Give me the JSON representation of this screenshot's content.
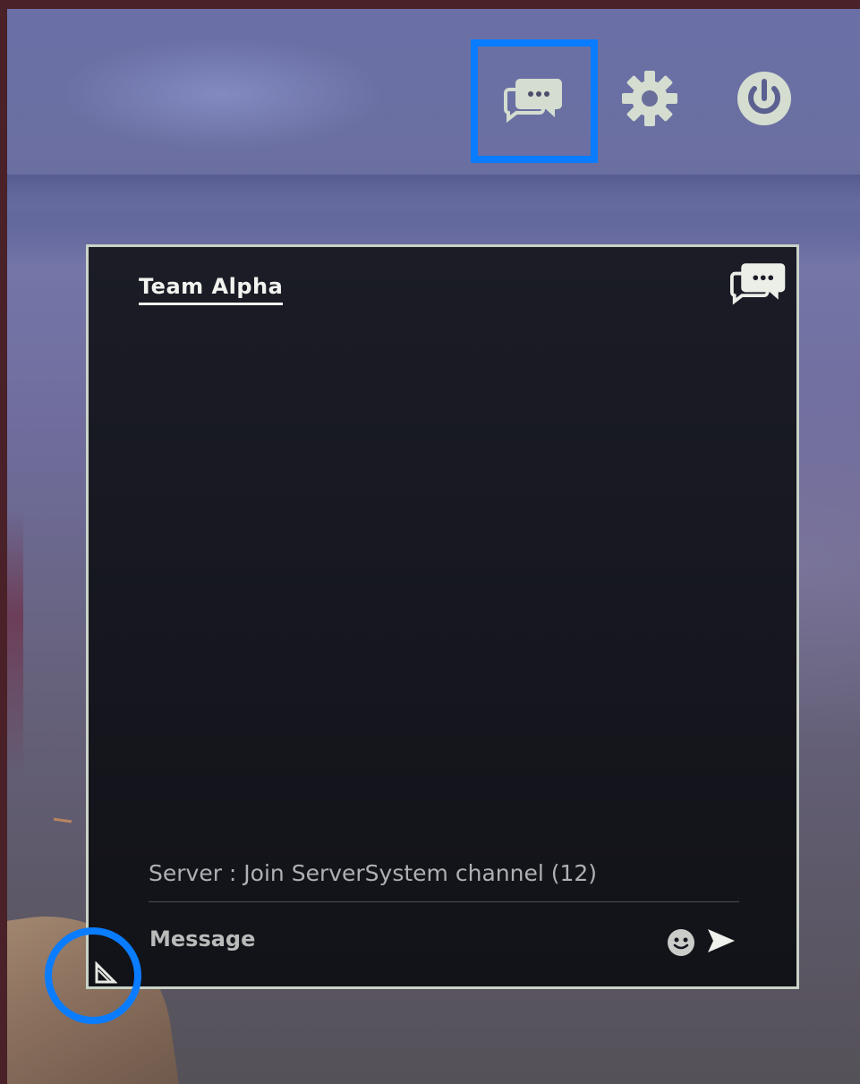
{
  "toolbar": {
    "icons": [
      "chat-icon",
      "gear-icon",
      "power-icon"
    ]
  },
  "chat": {
    "channel_name": "Team Alpha",
    "messages": [
      "Server : Join ServerSystem channel (12)"
    ],
    "input_placeholder": "Message"
  },
  "colors": {
    "highlight": "#0a7cff",
    "panel_border": "#c9d2c7",
    "icon": "#d4ddd0",
    "panel_bg": "#16171f"
  }
}
